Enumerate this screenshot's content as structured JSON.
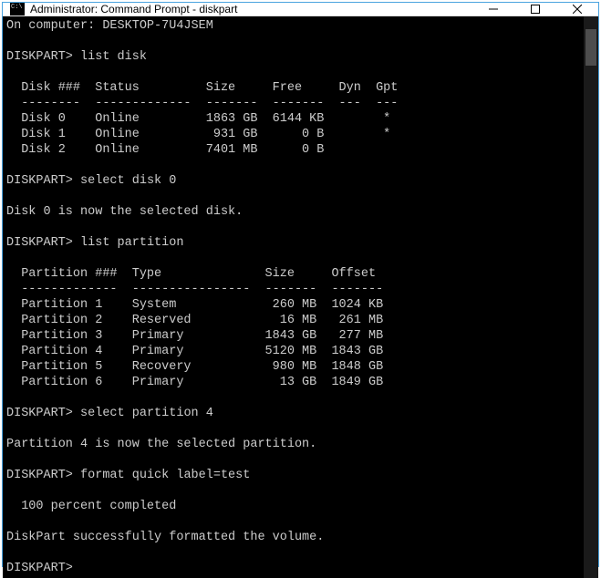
{
  "window": {
    "title": "Administrator: Command Prompt - diskpart"
  },
  "terminal": {
    "computer_line": "On computer: DESKTOP-7U4JSEM",
    "prompt": "DISKPART>",
    "cmd_list_disk": "list disk",
    "disk_header": "  Disk ###  Status         Size     Free     Dyn  Gpt",
    "disk_divider": "  --------  -------------  -------  -------  ---  ---",
    "disks": [
      "  Disk 0    Online         1863 GB  6144 KB        *",
      "  Disk 1    Online          931 GB      0 B        *",
      "  Disk 2    Online         7401 MB      0 B"
    ],
    "cmd_select_disk": "select disk 0",
    "msg_disk_selected": "Disk 0 is now the selected disk.",
    "cmd_list_partition": "list partition",
    "part_header": "  Partition ###  Type              Size     Offset",
    "part_divider": "  -------------  ----------------  -------  -------",
    "partitions": [
      "  Partition 1    System             260 MB  1024 KB",
      "  Partition 2    Reserved            16 MB   261 MB",
      "  Partition 3    Primary           1843 GB   277 MB",
      "  Partition 4    Primary           5120 MB  1843 GB",
      "  Partition 5    Recovery           980 MB  1848 GB",
      "  Partition 6    Primary             13 GB  1849 GB"
    ],
    "cmd_select_partition": "select partition 4",
    "msg_partition_selected": "Partition 4 is now the selected partition.",
    "cmd_format": "format quick label=test",
    "msg_progress": "  100 percent completed",
    "msg_success": "DiskPart successfully formatted the volume."
  },
  "chart_data": {
    "type": "table",
    "tables": [
      {
        "name": "list disk",
        "columns": [
          "Disk ###",
          "Status",
          "Size",
          "Free",
          "Dyn",
          "Gpt"
        ],
        "rows": [
          [
            "Disk 0",
            "Online",
            "1863 GB",
            "6144 KB",
            "",
            "*"
          ],
          [
            "Disk 1",
            "Online",
            "931 GB",
            "0 B",
            "",
            "*"
          ],
          [
            "Disk 2",
            "Online",
            "7401 MB",
            "0 B",
            "",
            ""
          ]
        ]
      },
      {
        "name": "list partition",
        "columns": [
          "Partition ###",
          "Type",
          "Size",
          "Offset"
        ],
        "rows": [
          [
            "Partition 1",
            "System",
            "260 MB",
            "1024 KB"
          ],
          [
            "Partition 2",
            "Reserved",
            "16 MB",
            "261 MB"
          ],
          [
            "Partition 3",
            "Primary",
            "1843 GB",
            "277 MB"
          ],
          [
            "Partition 4",
            "Primary",
            "5120 MB",
            "1843 GB"
          ],
          [
            "Partition 5",
            "Recovery",
            "980 MB",
            "1848 GB"
          ],
          [
            "Partition 6",
            "Primary",
            "13 GB",
            "1849 GB"
          ]
        ]
      }
    ]
  }
}
